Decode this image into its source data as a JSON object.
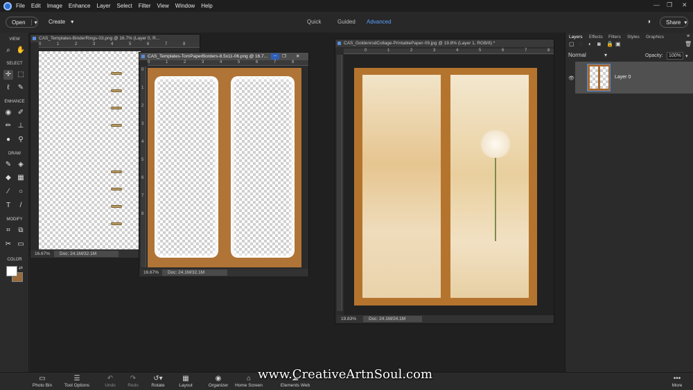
{
  "menu": [
    "File",
    "Edit",
    "Image",
    "Enhance",
    "Layer",
    "Select",
    "Filter",
    "View",
    "Window",
    "Help"
  ],
  "modebar": {
    "open": "Open",
    "create": "Create",
    "tabs": [
      "Quick",
      "Guided",
      "Advanced"
    ],
    "active_tab": "Advanced",
    "share": "Share"
  },
  "toolbar": {
    "sections": [
      "VIEW",
      "SELECT",
      "ENHANCE",
      "DRAW",
      "MODIFY",
      "COLOR"
    ]
  },
  "documents": [
    {
      "title": "CAS_Templates-BinderRings-03.png @ 16.7% (Layer 0, R...",
      "zoom": "16.67%",
      "doc": "Doc: 24.1M/32.1M"
    },
    {
      "title": "CAS_Templates-TornPaperBorders-8.5x11-06.png @ 16.7...",
      "zoom": "16.67%",
      "doc": "Doc: 24.1M/32.1M"
    },
    {
      "title": "CAS_GoldenrodCollage-PrintablePaper-09.jpg @ 19.8% (Layer 1, RGB/8) *",
      "zoom": "19.83%",
      "doc": "Doc: 24.1M/24.1M"
    }
  ],
  "ruler_numbers": [
    "0",
    "1",
    "2",
    "3",
    "4",
    "5",
    "6",
    "7",
    "8"
  ],
  "panel": {
    "tabs": [
      "Layers",
      "Effects",
      "Filters",
      "Styles",
      "Graphics"
    ],
    "active_tab": "Layers",
    "blend_mode": "Normal",
    "opacity_label": "Opacity:",
    "opacity_value": "100%",
    "layer_name": "Layer 0"
  },
  "bottombar": [
    {
      "label": "Photo Bin",
      "icon": "photo-bin-icon"
    },
    {
      "label": "Tool Options",
      "icon": "tool-options-icon"
    },
    {
      "label": "Undo",
      "icon": "undo-icon"
    },
    {
      "label": "Redo",
      "icon": "redo-icon"
    },
    {
      "label": "Rotate",
      "icon": "rotate-icon"
    },
    {
      "label": "Layout",
      "icon": "layout-icon"
    },
    {
      "label": "Organizer",
      "icon": "organizer-icon"
    },
    {
      "label": "Home Screen",
      "icon": "home-icon"
    },
    {
      "label": "Elements Web",
      "icon": "elements-web-icon"
    },
    {
      "label": "More",
      "icon": "more-icon"
    }
  ],
  "watermark": "www.CreativeArtnSoul.com"
}
